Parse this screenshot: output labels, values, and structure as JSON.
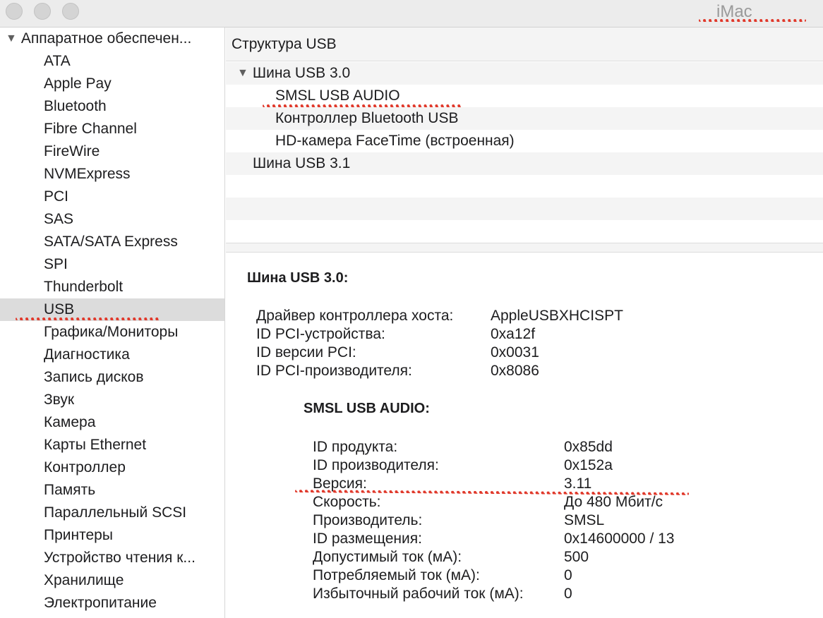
{
  "window": {
    "title": "iMac"
  },
  "sidebar": {
    "root_label": "Аппаратное обеспечен...",
    "items": [
      {
        "label": "ATA"
      },
      {
        "label": "Apple Pay"
      },
      {
        "label": "Bluetooth"
      },
      {
        "label": "Fibre Channel"
      },
      {
        "label": "FireWire"
      },
      {
        "label": "NVMExpress"
      },
      {
        "label": "PCI"
      },
      {
        "label": "SAS"
      },
      {
        "label": "SATA/SATA Express"
      },
      {
        "label": "SPI"
      },
      {
        "label": "Thunderbolt"
      },
      {
        "label": "USB"
      },
      {
        "label": "Графика/Мониторы"
      },
      {
        "label": "Диагностика"
      },
      {
        "label": "Запись дисков"
      },
      {
        "label": "Звук"
      },
      {
        "label": "Камера"
      },
      {
        "label": "Карты Ethernet"
      },
      {
        "label": "Контроллер"
      },
      {
        "label": "Память"
      },
      {
        "label": "Параллельный SCSI"
      },
      {
        "label": "Принтеры"
      },
      {
        "label": "Устройство чтения к..."
      },
      {
        "label": "Хранилище"
      },
      {
        "label": "Электропитание"
      }
    ],
    "selected": "USB"
  },
  "tree": {
    "header": "Структура USB",
    "rows": [
      {
        "label": "Шина USB 3.0"
      },
      {
        "label": "SMSL USB AUDIO"
      },
      {
        "label": "Контроллер Bluetooth USB"
      },
      {
        "label": "HD-камера FaceTime (встроенная)"
      },
      {
        "label": "Шина USB 3.1"
      }
    ]
  },
  "detail": {
    "bus_title": "Шина USB 3.0:",
    "bus_props": [
      {
        "label": "Драйвер контроллера хоста:",
        "value": "AppleUSBXHCISPT"
      },
      {
        "label": "ID PCI-устройства:",
        "value": "0xa12f"
      },
      {
        "label": "ID версии PCI:",
        "value": "0x0031"
      },
      {
        "label": "ID PCI-производителя:",
        "value": "0x8086"
      }
    ],
    "device_title": "SMSL USB AUDIO:",
    "device_props": [
      {
        "label": "ID продукта:",
        "value": "0x85dd"
      },
      {
        "label": "ID производителя:",
        "value": "0x152a"
      },
      {
        "label": "Версия:",
        "value": "3.11"
      },
      {
        "label": "Скорость:",
        "value": "До 480 Мбит/с"
      },
      {
        "label": "Производитель:",
        "value": "SMSL"
      },
      {
        "label": "ID размещения:",
        "value": "0x14600000 / 13"
      },
      {
        "label": "Допустимый ток (мА):",
        "value": "500"
      },
      {
        "label": "Потребляемый ток (мА):",
        "value": "0"
      },
      {
        "label": "Избыточный рабочий ток (мА):",
        "value": "0"
      }
    ]
  },
  "colors": {
    "annotation": "#e0392b",
    "selection": "#dcdcdc"
  }
}
